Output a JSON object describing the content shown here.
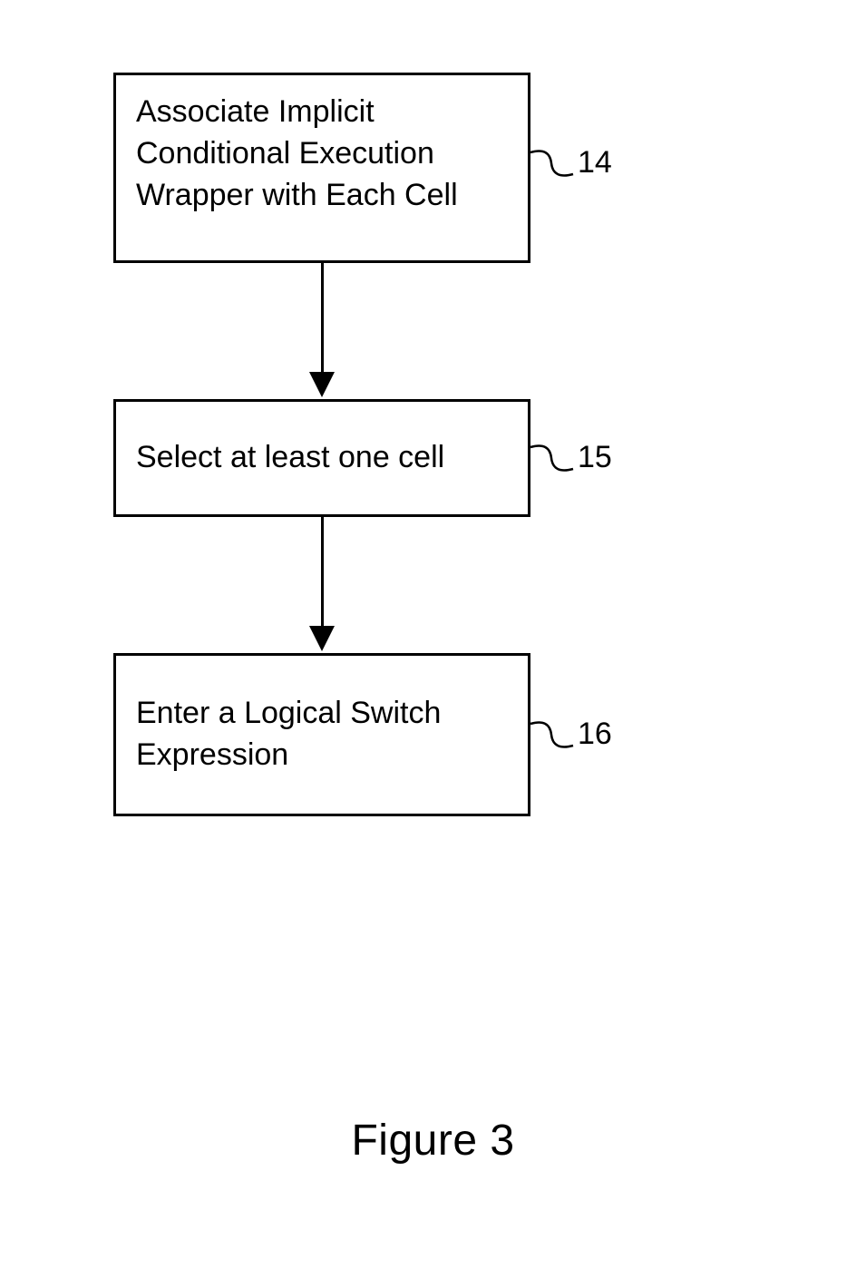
{
  "flowchart": {
    "steps": [
      {
        "id": "14",
        "text": "Associate Implicit Conditional Execution Wrapper with Each Cell"
      },
      {
        "id": "15",
        "text": "Select at least one cell"
      },
      {
        "id": "16",
        "text": "Enter a Logical Switch Expression"
      }
    ]
  },
  "caption": "Figure 3"
}
